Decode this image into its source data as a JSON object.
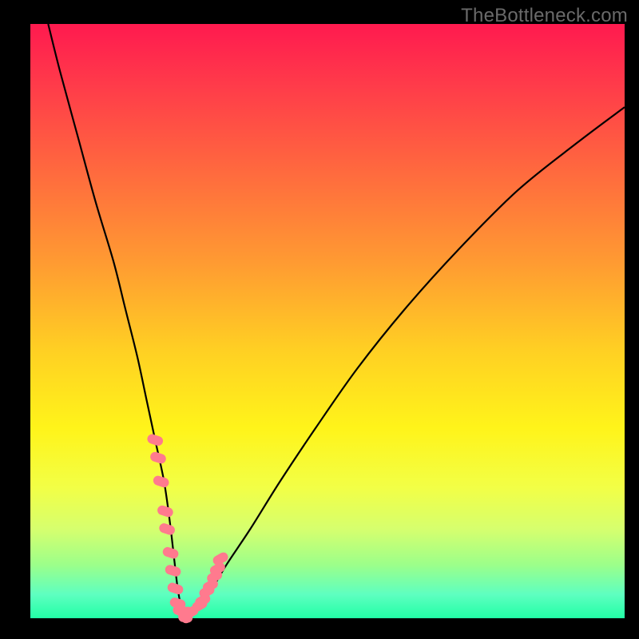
{
  "watermark": "TheBottleneck.com",
  "colors": {
    "frame": "#000000",
    "gradient_top": "#ff1a4f",
    "gradient_bottom": "#22ffa6",
    "curve": "#000000",
    "marker": "#ff7a8e"
  },
  "chart_data": {
    "type": "line",
    "title": "",
    "xlabel": "",
    "ylabel": "",
    "xlim": [
      0,
      100
    ],
    "ylim": [
      0,
      100
    ],
    "axes_visible": false,
    "series": [
      {
        "name": "bottleneck-curve",
        "x": [
          3,
          5,
          8,
          11,
          14,
          16,
          18,
          19.5,
          21,
          22.5,
          23.5,
          24.2,
          24.8,
          25.5,
          26.5,
          27,
          28,
          30,
          33,
          37,
          42,
          48,
          55,
          63,
          72,
          82,
          92,
          100
        ],
        "y": [
          100,
          92,
          81,
          70,
          60,
          52,
          44,
          37,
          30,
          23,
          16,
          10,
          5,
          1.5,
          0.3,
          0.5,
          1.5,
          4,
          9,
          15,
          23,
          32,
          42,
          52,
          62,
          72,
          80,
          86
        ]
      }
    ],
    "markers": {
      "name": "highlight-points",
      "x": [
        21,
        21.5,
        22,
        22.7,
        23,
        23.6,
        24,
        24.4,
        24.8,
        25.3,
        25.7,
        26.2,
        26.5,
        27,
        28.5,
        29,
        29.7,
        30.3,
        31,
        31.5,
        32
      ],
      "y": [
        30,
        27,
        23,
        18,
        15,
        11,
        8,
        5,
        2.5,
        1.2,
        0.7,
        0.5,
        0.6,
        1,
        2.2,
        3,
        4.5,
        5.5,
        7,
        8.3,
        10
      ]
    }
  }
}
